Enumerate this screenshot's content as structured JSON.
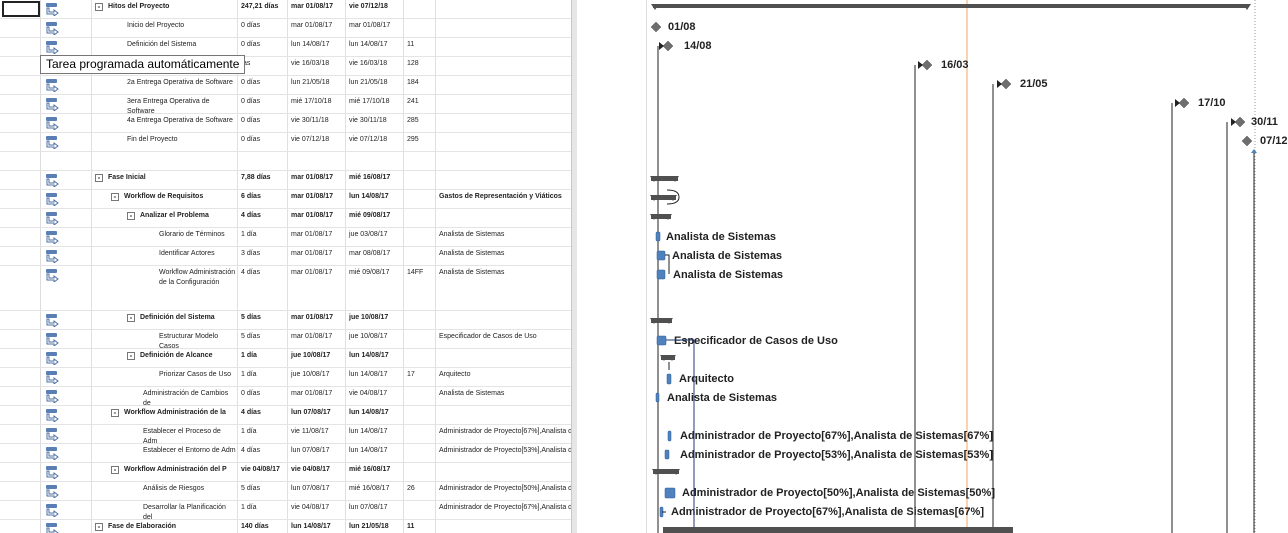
{
  "grid": {
    "rows": [
      {
        "name": "Hitos del Proyecto",
        "indent": 0,
        "summary": true,
        "expand": "-",
        "duration": "247,21 días",
        "start": "mar 01/08/17",
        "end": "vie 07/12/18",
        "pred": "",
        "resource": ""
      },
      {
        "name": "Inicio del Proyecto",
        "indent": 2,
        "duration": "0 días",
        "start": "mar 01/08/17",
        "end": "mar 01/08/17",
        "pred": "",
        "resource": ""
      },
      {
        "name": "Definición del Sistema",
        "indent": 2,
        "duration": "0 días",
        "start": "lun 14/08/17",
        "end": "lun 14/08/17",
        "pred": "11",
        "resource": ""
      },
      {
        "name": "",
        "indent": 2,
        "duration": "ías",
        "start": "vie 16/03/18",
        "end": "vie 16/03/18",
        "pred": "128",
        "resource": ""
      },
      {
        "name": "2a Entrega Operativa de Software",
        "indent": 2,
        "duration": "0 días",
        "start": "lun 21/05/18",
        "end": "lun 21/05/18",
        "pred": "184",
        "resource": ""
      },
      {
        "name": "3era Entrega Operativa de Software",
        "indent": 2,
        "duration": "0 días",
        "start": "mié 17/10/18",
        "end": "mié 17/10/18",
        "pred": "241",
        "resource": ""
      },
      {
        "name": "4a Entrega Operativa de Software",
        "indent": 2,
        "duration": "0 días",
        "start": "vie 30/11/18",
        "end": "vie 30/11/18",
        "pred": "285",
        "resource": ""
      },
      {
        "name": "Fin del Proyecto",
        "indent": 2,
        "duration": "0 días",
        "start": "vie 07/12/18",
        "end": "vie 07/12/18",
        "pred": "295",
        "resource": ""
      },
      {
        "name": "",
        "blank": true,
        "duration": "",
        "start": "",
        "end": "",
        "pred": "",
        "resource": ""
      },
      {
        "name": "Fase Inicial",
        "indent": 0,
        "summary": true,
        "expand": "-",
        "duration": "7,88 días",
        "start": "mar 01/08/17",
        "end": "mié 16/08/17",
        "pred": "",
        "resource": ""
      },
      {
        "name": "Workflow de Requisitos",
        "indent": 1,
        "summary": true,
        "expand": "-",
        "duration": "6 días",
        "start": "mar 01/08/17",
        "end": "lun 14/08/17",
        "pred": "",
        "resource": "Gastos de Representación y Viáticos"
      },
      {
        "name": "Analizar el Problema",
        "indent": 2,
        "summary": true,
        "expand": "-",
        "duration": "4 días",
        "start": "mar 01/08/17",
        "end": "mié 09/08/17",
        "pred": "",
        "resource": ""
      },
      {
        "name": "Glorario de Términos",
        "indent": 4,
        "duration": "1 día",
        "start": "mar 01/08/17",
        "end": "jue 03/08/17",
        "pred": "",
        "resource": "Analista de Sistemas"
      },
      {
        "name": "Identificar Actores",
        "indent": 4,
        "duration": "3 días",
        "start": "mar 01/08/17",
        "end": "mar 08/08/17",
        "pred": "",
        "resource": "Analista de Sistemas"
      },
      {
        "name": "Workflow Administración de la Configuración",
        "indent": 4,
        "tall": true,
        "duration": "4 días",
        "start": "mar 01/08/17",
        "end": "mié 09/08/17",
        "pred": "14FF",
        "resource": "Analista de Sistemas"
      },
      {
        "name": "Definición del Sistema",
        "indent": 2,
        "summary": true,
        "expand": "-",
        "duration": "5 días",
        "start": "mar 01/08/17",
        "end": "jue 10/08/17",
        "pred": "",
        "resource": ""
      },
      {
        "name": "Estructurar Modelo Casos",
        "indent": 4,
        "duration": "5 días",
        "start": "mar 01/08/17",
        "end": "jue 10/08/17",
        "pred": "",
        "resource": "Especificador de Casos de Uso"
      },
      {
        "name": "Definición de Alcance",
        "indent": 2,
        "summary": true,
        "expand": "-",
        "duration": "1 día",
        "start": "jue 10/08/17",
        "end": "lun 14/08/17",
        "pred": "",
        "resource": ""
      },
      {
        "name": "Priorizar Casos de Uso",
        "indent": 4,
        "duration": "1 día",
        "start": "jue 10/08/17",
        "end": "lun 14/08/17",
        "pred": "17",
        "resource": "Arquitecto"
      },
      {
        "name": "Administración de Cambios de",
        "indent": 3,
        "duration": "0 días",
        "start": "mar 01/08/17",
        "end": "vie 04/08/17",
        "pred": "",
        "resource": "Analista de Sistemas"
      },
      {
        "name": "Workflow Administración de la",
        "indent": 1,
        "summary": true,
        "expand": "-",
        "duration": "4 días",
        "start": "lun 07/08/17",
        "end": "lun 14/08/17",
        "pred": "",
        "resource": ""
      },
      {
        "name": "Establecer el Proceso de Adm",
        "indent": 3,
        "duration": "1 día",
        "start": "vie 11/08/17",
        "end": "lun 14/08/17",
        "pred": "",
        "resource": "Administrador de Proyecto[67%],Analista de Sistemas[67%]"
      },
      {
        "name": "Establecer el Entorno de Adm",
        "indent": 3,
        "duration": "4 días",
        "start": "lun 07/08/17",
        "end": "lun 14/08/17",
        "pred": "",
        "resource": "Administrador de Proyecto[53%],Analista de Sistemas[53%]"
      },
      {
        "name": "Workflow Administración del P",
        "indent": 1,
        "summary": true,
        "expand": "-",
        "duration": "vie 04/08/17",
        "start": "vie 04/08/17",
        "end": "mié 16/08/17",
        "pred": "",
        "resource": ""
      },
      {
        "name": "Análisis de Riesgos",
        "indent": 3,
        "duration": "5 días",
        "start": "lun 07/08/17",
        "end": "mié 16/08/17",
        "pred": "26",
        "resource": "Administrador de Proyecto[50%],Analista de Sistemas[50%]"
      },
      {
        "name": "Desarrollar la Planificación del",
        "indent": 3,
        "duration": "1 día",
        "start": "vie 04/08/17",
        "end": "lun 07/08/17",
        "pred": "",
        "resource": "Administrador de Proyecto[67%],Analista de Sistemas[67%]"
      },
      {
        "name": "Fase de Elaboración",
        "indent": 0,
        "summary": true,
        "expand": "-",
        "duration": "140 días",
        "start": "lun 14/08/17",
        "end": "lun 21/05/18",
        "pred": "11",
        "resource": ""
      }
    ]
  },
  "tooltip": {
    "text": "Tarea programada automáticamente"
  },
  "gantt": {
    "milestone_labels": [
      "01/08",
      "14/08",
      "16/03",
      "21/05",
      "17/10",
      "30/11",
      "07/12"
    ],
    "resource_labels": [
      "Analista de Sistemas",
      "Analista de Sistemas",
      "Analista de Sistemas",
      "Especificador de Casos de Uso",
      "Arquitecto",
      "Analista de Sistemas",
      "Administrador de Proyecto[67%],Analista de Sistemas[67%]",
      "Administrador de Proyecto[53%],Analista de Sistemas[53%]",
      "Administrador de Proyecto[50%],Analista de Sistemas[50%]",
      "Administrador de Proyecto[67%],Analista de Sistemas[67%]"
    ],
    "colors": {
      "bar": "#4f81bd",
      "summary": "#505050",
      "milestone": "#6e6e6e",
      "today_line": "#f4a460",
      "link": "#1f3b73"
    }
  }
}
